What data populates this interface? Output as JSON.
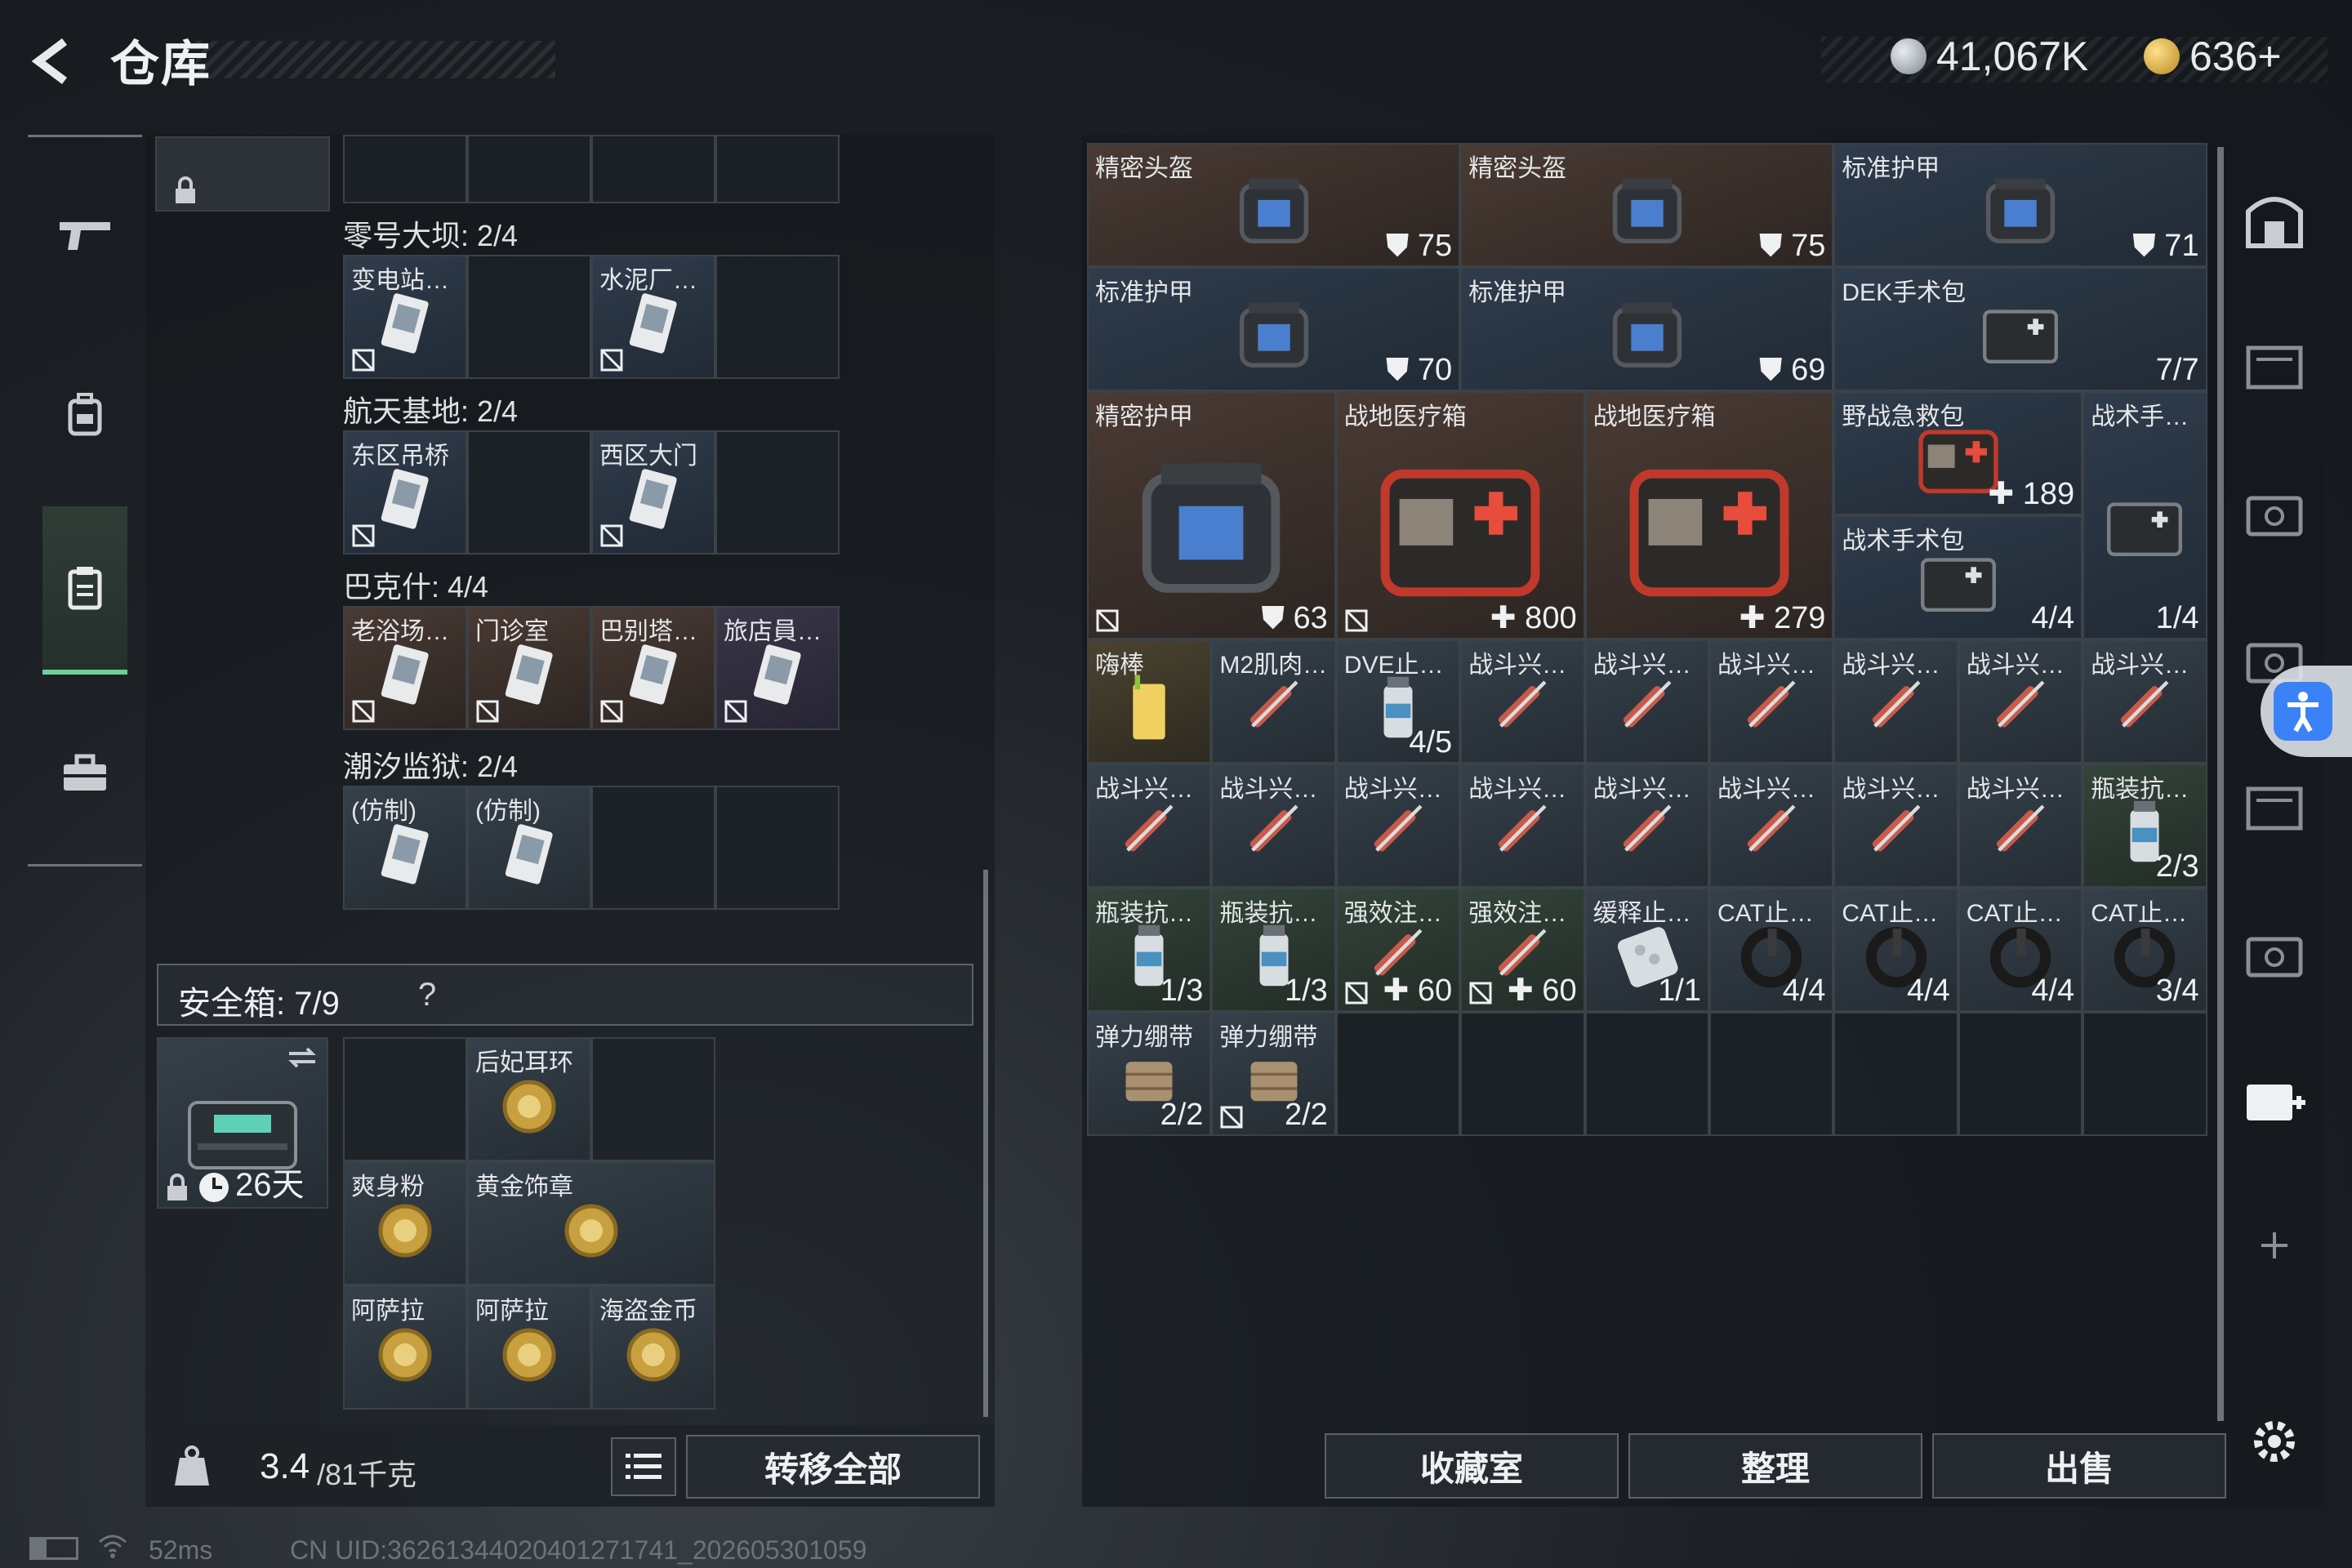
{
  "header": {
    "title": "仓库",
    "currency_1": "41,067K",
    "currency_2": "636+"
  },
  "leftnav": [
    "gun-icon",
    "backpack-icon",
    "storage-icon",
    "briefcase-icon"
  ],
  "keys": {
    "sections": [
      {
        "title": "零号大坝: 2/4",
        "items": [
          {
            "name": "变电站…",
            "color": "blue"
          },
          {
            "name": ""
          },
          {
            "name": "水泥厂…",
            "color": "blue"
          },
          {
            "name": ""
          }
        ]
      },
      {
        "title": "航天基地: 2/4",
        "items": [
          {
            "name": "东区吊桥",
            "color": "blue"
          },
          {
            "name": ""
          },
          {
            "name": "西区大门",
            "color": "blue"
          },
          {
            "name": ""
          }
        ]
      },
      {
        "title": "巴克什: 4/4",
        "items": [
          {
            "name": "老浴场…",
            "color": "red"
          },
          {
            "name": "门诊室",
            "color": "red"
          },
          {
            "name": "巴别塔…",
            "color": "red"
          },
          {
            "name": "旅店員…",
            "color": "purple"
          }
        ]
      },
      {
        "title": "潮汐监狱: 2/4",
        "items": [
          {
            "name": "(仿制)",
            "color": "filled"
          },
          {
            "name": "(仿制)",
            "color": "filled"
          },
          {
            "name": ""
          },
          {
            "name": ""
          }
        ]
      }
    ]
  },
  "safebox": {
    "label": "安全箱: 7/9",
    "help": "?",
    "timer": "26天",
    "items": [
      {
        "name": "",
        "color": ""
      },
      {
        "name": "后妃耳环",
        "color": "filled"
      },
      {
        "name": "",
        "color": ""
      },
      {
        "name": "爽身粉",
        "color": "filled"
      },
      {
        "name": "黄金饰章",
        "color": "filled"
      },
      {
        "name": "阿萨拉",
        "color": "filled"
      },
      {
        "name": "阿萨拉",
        "color": "filled"
      },
      {
        "name": "海盗金币",
        "color": "filled"
      }
    ]
  },
  "footer": {
    "weight": "3.4",
    "weight_max": "/81千克",
    "transfer_all": "转移全部"
  },
  "status": {
    "ping": "52ms",
    "uid": "CN UID:36261344020401271741_202605301059"
  },
  "storage_items": [
    {
      "name": "精密头盔",
      "qty": "75",
      "shield": true,
      "color": "red",
      "col": 0,
      "row": 0,
      "w": 3,
      "h": 1,
      "kind": "armor"
    },
    {
      "name": "精密头盔",
      "qty": "75",
      "shield": true,
      "color": "red",
      "col": 3,
      "row": 0,
      "w": 3,
      "h": 1,
      "kind": "armor"
    },
    {
      "name": "标准护甲",
      "qty": "71",
      "shield": true,
      "color": "blue",
      "col": 6,
      "row": 0,
      "w": 3,
      "h": 1,
      "kind": "armor"
    },
    {
      "name": "标准护甲",
      "qty": "70",
      "shield": true,
      "color": "blue",
      "col": 0,
      "row": 1,
      "w": 3,
      "h": 1,
      "kind": "armor"
    },
    {
      "name": "标准护甲",
      "qty": "69",
      "shield": true,
      "color": "blue",
      "col": 3,
      "row": 1,
      "w": 3,
      "h": 1,
      "kind": "armor"
    },
    {
      "name": "DEK手术包",
      "qty": "7/7",
      "color": "blue",
      "col": 6,
      "row": 1,
      "w": 3,
      "h": 1,
      "kind": "bag"
    },
    {
      "name": "精密护甲",
      "qty": "63",
      "shield": true,
      "lock": true,
      "color": "red",
      "col": 0,
      "row": 2,
      "w": 2,
      "h": 2,
      "kind": "armor"
    },
    {
      "name": "战地医疗箱",
      "qty": "800",
      "plus": true,
      "lock": true,
      "color": "red",
      "col": 2,
      "row": 2,
      "w": 2,
      "h": 2,
      "kind": "medkit"
    },
    {
      "name": "战地医疗箱",
      "qty": "279",
      "plus": true,
      "color": "red",
      "col": 4,
      "row": 2,
      "w": 2,
      "h": 2,
      "kind": "medkit"
    },
    {
      "name": "野战急救包",
      "qty": "189",
      "plus": true,
      "color": "blue",
      "col": 6,
      "row": 2,
      "w": 2,
      "h": 1,
      "kind": "medkit"
    },
    {
      "name": "战术手…",
      "qty": "1/4",
      "color": "blue",
      "col": 8,
      "row": 2,
      "w": 1,
      "h": 2,
      "kind": "bag"
    },
    {
      "name": "战术手术包",
      "qty": "4/4",
      "color": "blue",
      "col": 6,
      "row": 3,
      "w": 2,
      "h": 1,
      "kind": "bag"
    },
    {
      "name": "嗨棒",
      "qty": "",
      "color": "gold",
      "col": 0,
      "row": 4,
      "w": 1,
      "h": 1,
      "kind": "drink"
    },
    {
      "name": "M2肌肉…",
      "qty": "",
      "color": "filled",
      "col": 1,
      "row": 4,
      "w": 1,
      "h": 1,
      "kind": "syringe"
    },
    {
      "name": "DVE止…",
      "qty": "4/5",
      "color": "filled",
      "col": 2,
      "row": 4,
      "w": 1,
      "h": 1,
      "kind": "bottle"
    },
    {
      "name": "战斗兴…",
      "qty": "",
      "color": "filled",
      "col": 3,
      "row": 4,
      "w": 1,
      "h": 1,
      "kind": "syringe"
    },
    {
      "name": "战斗兴…",
      "qty": "",
      "color": "filled",
      "col": 4,
      "row": 4,
      "w": 1,
      "h": 1,
      "kind": "syringe"
    },
    {
      "name": "战斗兴…",
      "qty": "",
      "color": "filled",
      "col": 5,
      "row": 4,
      "w": 1,
      "h": 1,
      "kind": "syringe"
    },
    {
      "name": "战斗兴…",
      "qty": "",
      "color": "filled",
      "col": 6,
      "row": 4,
      "w": 1,
      "h": 1,
      "kind": "syringe"
    },
    {
      "name": "战斗兴…",
      "qty": "",
      "color": "filled",
      "col": 7,
      "row": 4,
      "w": 1,
      "h": 1,
      "kind": "syringe"
    },
    {
      "name": "战斗兴…",
      "qty": "",
      "color": "filled",
      "col": 8,
      "row": 4,
      "w": 1,
      "h": 1,
      "kind": "syringe"
    },
    {
      "name": "战斗兴…",
      "qty": "",
      "color": "filled",
      "col": 0,
      "row": 5,
      "w": 1,
      "h": 1,
      "kind": "syringe"
    },
    {
      "name": "战斗兴…",
      "qty": "",
      "color": "filled",
      "col": 1,
      "row": 5,
      "w": 1,
      "h": 1,
      "kind": "syringe"
    },
    {
      "name": "战斗兴…",
      "qty": "",
      "color": "filled",
      "col": 2,
      "row": 5,
      "w": 1,
      "h": 1,
      "kind": "syringe"
    },
    {
      "name": "战斗兴…",
      "qty": "",
      "color": "filled",
      "col": 3,
      "row": 5,
      "w": 1,
      "h": 1,
      "kind": "syringe"
    },
    {
      "name": "战斗兴…",
      "qty": "",
      "color": "filled",
      "col": 4,
      "row": 5,
      "w": 1,
      "h": 1,
      "kind": "syringe"
    },
    {
      "name": "战斗兴…",
      "qty": "",
      "color": "filled",
      "col": 5,
      "row": 5,
      "w": 1,
      "h": 1,
      "kind": "syringe"
    },
    {
      "name": "战斗兴…",
      "qty": "",
      "color": "filled",
      "col": 6,
      "row": 5,
      "w": 1,
      "h": 1,
      "kind": "syringe"
    },
    {
      "name": "战斗兴…",
      "qty": "",
      "color": "filled",
      "col": 7,
      "row": 5,
      "w": 1,
      "h": 1,
      "kind": "syringe"
    },
    {
      "name": "瓶装抗…",
      "qty": "2/3",
      "color": "green",
      "col": 8,
      "row": 5,
      "w": 1,
      "h": 1,
      "kind": "bottle"
    },
    {
      "name": "瓶装抗…",
      "qty": "1/3",
      "color": "green",
      "col": 0,
      "row": 6,
      "w": 1,
      "h": 1,
      "kind": "bottle"
    },
    {
      "name": "瓶装抗…",
      "qty": "1/3",
      "color": "green",
      "col": 1,
      "row": 6,
      "w": 1,
      "h": 1,
      "kind": "bottle"
    },
    {
      "name": "强效注…",
      "qty": "60",
      "plus": true,
      "lock": true,
      "color": "green",
      "col": 2,
      "row": 6,
      "w": 1,
      "h": 1,
      "kind": "syringe"
    },
    {
      "name": "强效注…",
      "qty": "60",
      "plus": true,
      "lock": true,
      "color": "green",
      "col": 3,
      "row": 6,
      "w": 1,
      "h": 1,
      "kind": "syringe"
    },
    {
      "name": "缓释止…",
      "qty": "1/1",
      "color": "filled",
      "col": 4,
      "row": 6,
      "w": 1,
      "h": 1,
      "kind": "pills"
    },
    {
      "name": "CAT止…",
      "qty": "4/4",
      "color": "filled",
      "col": 5,
      "row": 6,
      "w": 1,
      "h": 1,
      "kind": "tourniquet"
    },
    {
      "name": "CAT止…",
      "qty": "4/4",
      "color": "filled",
      "col": 6,
      "row": 6,
      "w": 1,
      "h": 1,
      "kind": "tourniquet"
    },
    {
      "name": "CAT止…",
      "qty": "4/4",
      "color": "filled",
      "col": 7,
      "row": 6,
      "w": 1,
      "h": 1,
      "kind": "tourniquet"
    },
    {
      "name": "CAT止…",
      "qty": "3/4",
      "color": "filled",
      "col": 8,
      "row": 6,
      "w": 1,
      "h": 1,
      "kind": "tourniquet"
    },
    {
      "name": "弹力绷带",
      "qty": "2/2",
      "color": "filled",
      "col": 0,
      "row": 7,
      "w": 1,
      "h": 1,
      "kind": "bandage"
    },
    {
      "name": "弹力绷带",
      "qty": "2/2",
      "lock": true,
      "color": "filled",
      "col": 1,
      "row": 7,
      "w": 1,
      "h": 1,
      "kind": "bandage"
    }
  ],
  "bottom_buttons": {
    "collection": "收藏室",
    "organize": "整理",
    "sell": "出售"
  },
  "right_tabs": [
    "armor-stash-icon",
    "container-icon-2",
    "container-icon-3",
    "container-icon-4",
    "container-icon-5",
    "container-icon-6",
    "add-container-icon",
    "plus-icon",
    "gear-icon"
  ],
  "colors": {
    "accent": "#6ed19a",
    "accessibility": "#3b82f6"
  }
}
